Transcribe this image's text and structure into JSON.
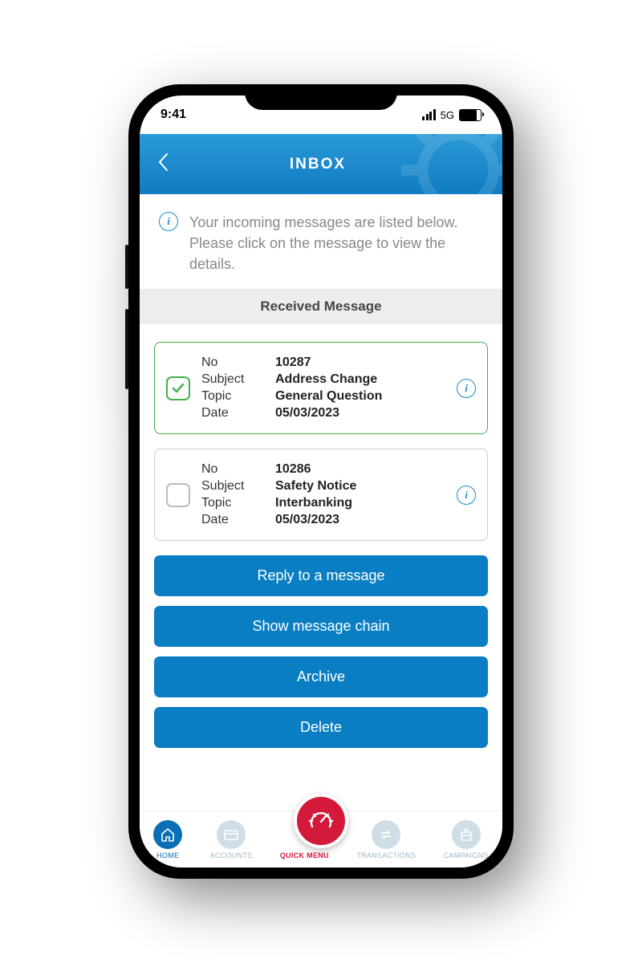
{
  "status": {
    "time": "9:41",
    "net": "5G"
  },
  "header": {
    "title": "INBOX"
  },
  "info": {
    "text": "Your incoming messages are listed below. Please click on the message to view the details."
  },
  "section": {
    "label": "Received Message"
  },
  "labels": {
    "no": "No",
    "subject": "Subject",
    "topic": "Topic",
    "date": "Date"
  },
  "messages": [
    {
      "selected": true,
      "no": "10287",
      "subject": "Address Change",
      "topic": "General Question",
      "date": "05/03/2023"
    },
    {
      "selected": false,
      "no": "10286",
      "subject": "Safety Notice",
      "topic": "Interbanking",
      "date": "05/03/2023"
    }
  ],
  "actions": {
    "reply": "Reply to a message",
    "chain": "Show message chain",
    "archive": "Archive",
    "delete": "Delete"
  },
  "nav": {
    "home": "HOME",
    "accounts": "ACCOUNTS",
    "quick": "QUICK MENU",
    "transactions": "TRANSACTIONS",
    "campaigns": "CAMPAIGNS"
  }
}
